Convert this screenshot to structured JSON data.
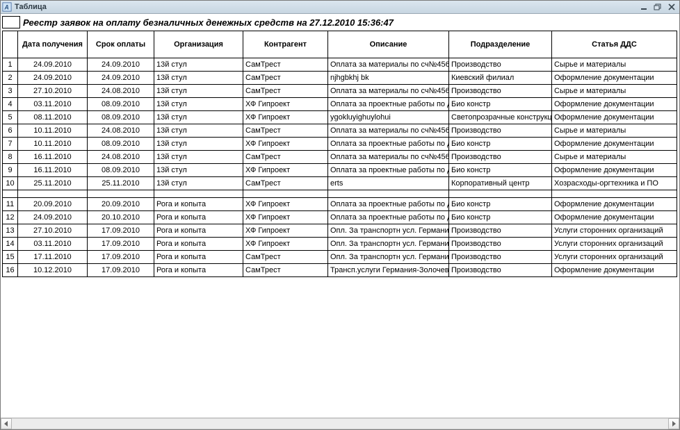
{
  "window": {
    "title": "Таблица"
  },
  "report": {
    "title": "Реестр заявок на оплату безналичных денежных средств на 27.12.2010 15:36:47"
  },
  "columns": {
    "idx": "",
    "received": "Дата получения",
    "due": "Срок оплаты",
    "org": "Организация",
    "counterparty": "Контрагент",
    "desc": "Описание",
    "dept": "Подразделение",
    "dds": "Статья ДДС"
  },
  "rows1": [
    {
      "idx": "1",
      "received": "24.09.2010",
      "due": "24.09.2010",
      "org": "13й стул",
      "counterparty": "СамТрест",
      "desc": "Оплата за материалы по сч№456",
      "dept": "Производство",
      "dds": "Сырье и материалы"
    },
    {
      "idx": "2",
      "received": "24.09.2010",
      "due": "24.09.2010",
      "org": "13й стул",
      "counterparty": "СамТрест",
      "desc": "njhgbkhj bk",
      "dept": "Киевский филиал",
      "dds": "Оформление документации"
    },
    {
      "idx": "3",
      "received": "27.10.2010",
      "due": "24.08.2010",
      "org": "13й стул",
      "counterparty": "СамТрест",
      "desc": "Оплата за материалы по сч№456",
      "dept": "Производство",
      "dds": "Сырье и материалы"
    },
    {
      "idx": "4",
      "received": "03.11.2010",
      "due": "08.09.2010",
      "org": "13й стул",
      "counterparty": "ХФ Гипроект",
      "desc": "Оплата за проектные работы по д",
      "dept": "Био констр",
      "dds": "Оформление документации"
    },
    {
      "idx": "5",
      "received": "08.11.2010",
      "due": "08.09.2010",
      "org": "13й стул",
      "counterparty": "ХФ Гипроект",
      "desc": "ygokluyighuylohui",
      "dept": "Светопрозрачные конструкц",
      "dds": "Оформление документации"
    },
    {
      "idx": "6",
      "received": "10.11.2010",
      "due": "24.08.2010",
      "org": "13й стул",
      "counterparty": "СамТрест",
      "desc": "Оплата за материалы по сч№456",
      "dept": "Производство",
      "dds": "Сырье и материалы"
    },
    {
      "idx": "7",
      "received": "10.11.2010",
      "due": "08.09.2010",
      "org": "13й стул",
      "counterparty": "ХФ Гипроект",
      "desc": "Оплата за проектные работы по д",
      "dept": "Био констр",
      "dds": "Оформление документации"
    },
    {
      "idx": "8",
      "received": "16.11.2010",
      "due": "24.08.2010",
      "org": "13й стул",
      "counterparty": "СамТрест",
      "desc": "Оплата за материалы по сч№456",
      "dept": "Производство",
      "dds": "Сырье и материалы"
    },
    {
      "idx": "9",
      "received": "16.11.2010",
      "due": "08.09.2010",
      "org": "13й стул",
      "counterparty": "ХФ Гипроект",
      "desc": "Оплата за проектные работы по д",
      "dept": "Био констр",
      "dds": "Оформление документации"
    },
    {
      "idx": "10",
      "received": "25.11.2010",
      "due": "25.11.2010",
      "org": "13й стул",
      "counterparty": "СамТрест",
      "desc": "erts",
      "dept": "Корпоративный центр",
      "dds": "Хозрасходы-оргтехника и ПО"
    }
  ],
  "rows2": [
    {
      "idx": "11",
      "received": "20.09.2010",
      "due": "20.09.2010",
      "org": "Рога и копыта",
      "counterparty": "ХФ Гипроект",
      "desc": "Оплата за проектные работы по д",
      "dept": "Био констр",
      "dds": "Оформление документации"
    },
    {
      "idx": "12",
      "received": "24.09.2010",
      "due": "20.10.2010",
      "org": "Рога и копыта",
      "counterparty": "ХФ Гипроект",
      "desc": "Оплата за проектные работы по д",
      "dept": "Био констр",
      "dds": "Оформление документации"
    },
    {
      "idx": "13",
      "received": "27.10.2010",
      "due": "17.09.2010",
      "org": "Рога и копыта",
      "counterparty": "ХФ Гипроект",
      "desc": "Опл. За транспортн усл. Германи",
      "dept": "Производство",
      "dds": "Услуги сторонних организаций"
    },
    {
      "idx": "14",
      "received": "03.11.2010",
      "due": "17.09.2010",
      "org": "Рога и копыта",
      "counterparty": "ХФ Гипроект",
      "desc": "Опл. За транспортн усл. Германи",
      "dept": "Производство",
      "dds": "Услуги сторонних организаций"
    },
    {
      "idx": "15",
      "received": "17.11.2010",
      "due": "17.09.2010",
      "org": "Рога и копыта",
      "counterparty": "СамТрест",
      "desc": "Опл. За транспортн усл. Германи",
      "dept": "Производство",
      "dds": "Услуги сторонних организаций"
    },
    {
      "idx": "16",
      "received": "10.12.2010",
      "due": "17.09.2010",
      "org": "Рога и копыта",
      "counterparty": "СамТрест",
      "desc": "Трансп.услуги Германия-Золочев",
      "dept": "Производство",
      "dds": "Оформление документации"
    }
  ]
}
